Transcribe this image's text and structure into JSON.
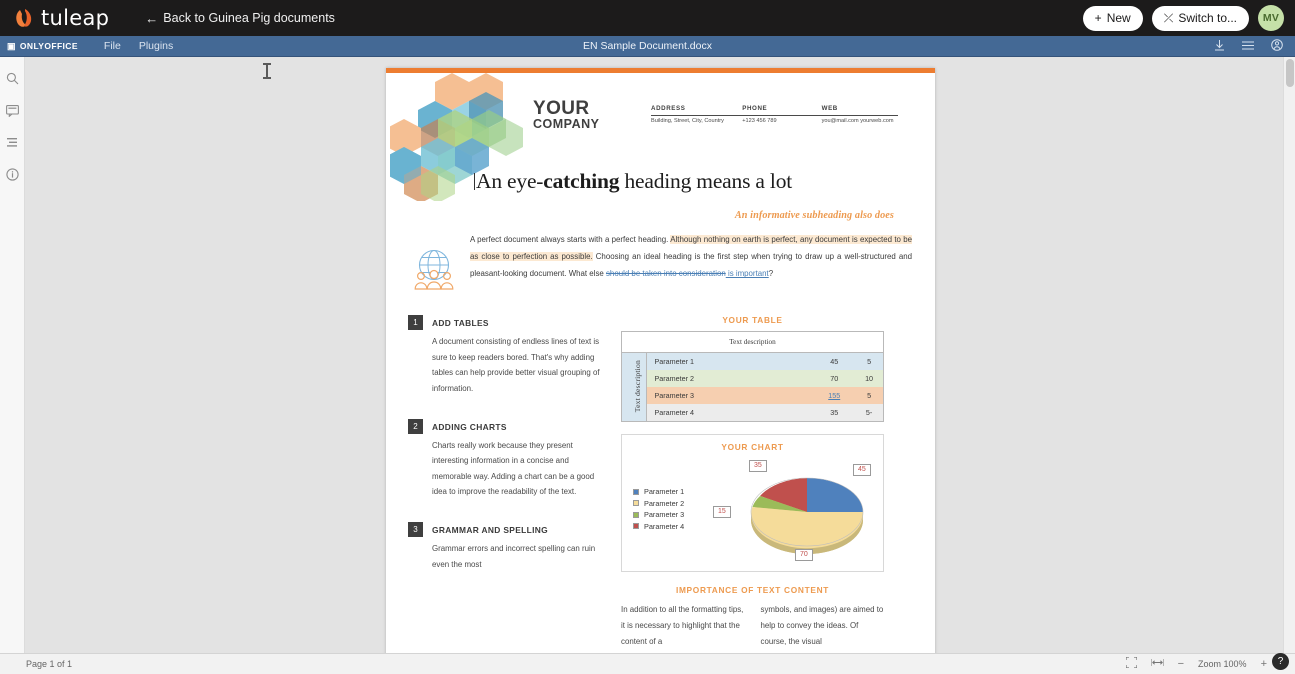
{
  "topbar": {
    "brand": "tuleap",
    "back_label": "Back to Guinea Pig documents",
    "back_arrow": "←",
    "new_label": "New",
    "new_glyph": "+",
    "switch_label": "Switch to...",
    "switch_glyph": "⤫",
    "avatar_initials": "MV",
    "avatar_color": "#c5e0a8"
  },
  "editor_bar": {
    "brand": "ONLYOFFICE",
    "menu": [
      "File",
      "Plugins"
    ],
    "document_title": "EN Sample Document.docx",
    "icons": [
      "download-icon",
      "menu-icon",
      "account-icon"
    ],
    "bg_color": "#446995"
  },
  "rail": {
    "items": [
      "search-icon",
      "comments-icon",
      "headings-icon",
      "about-icon"
    ]
  },
  "document": {
    "accent_color": "#ed7d31",
    "company_line1": "YOUR",
    "company_line2": "COMPANY",
    "contact": [
      {
        "heading": "ADDRESS",
        "value": "Building, Street, City, Country"
      },
      {
        "heading": "PHONE",
        "value": "+123 456 789"
      },
      {
        "heading": "WEB",
        "value": "you@mail.com yourweb.com"
      }
    ],
    "title_parts": [
      {
        "text": "An eye-",
        "bold": false
      },
      {
        "text": "catching",
        "bold": true
      },
      {
        "text": " heading means a lot",
        "bold": false
      }
    ],
    "title_plain": "An eye-catching heading means a lot",
    "subheading": "An informative subheading also does",
    "intro": {
      "p1": "A perfect document always starts with a perfect heading. ",
      "highlight": "Although nothing on earth is perfect, any document is expected to be as close to perfection as possible.",
      "p2": " Choosing an ideal heading is the first step when trying to draw up a well-structured and pleasant-looking document. What else ",
      "deleted": "should be taken into consideration",
      "inserted": " is important",
      "p3": "?"
    },
    "sections": [
      {
        "number": "1",
        "title": "ADD TABLES",
        "body": "A document consisting of endless lines of text is sure to keep readers bored. That's why adding tables can help provide better visual grouping of information."
      },
      {
        "number": "2",
        "title": "ADDING CHARTS",
        "body": "Charts really work because they present interesting information in a concise and memorable way. Adding a chart can be a good idea to improve the readability of the text."
      },
      {
        "number": "3",
        "title": "GRAMMAR AND SPELLING",
        "body": "Grammar errors and incorrect spelling can ruin even the most"
      }
    ],
    "table": {
      "caption": "YOUR TABLE",
      "column_header": "Text description",
      "row_header": "Text description",
      "rows": [
        {
          "label": "Parameter 1",
          "v1": "45",
          "v2": "5"
        },
        {
          "label": "Parameter 2",
          "v1": "70",
          "v2": "10"
        },
        {
          "label": "Parameter 3",
          "v1": "155",
          "v2": "5"
        },
        {
          "label": "Parameter 4",
          "v1": "35",
          "v2": "5-"
        }
      ],
      "row_colors": [
        "#d7e6f0",
        "#e2ecd4",
        "#f6cfb0",
        "#ececec"
      ]
    },
    "chart": {
      "caption": "YOUR CHART"
    },
    "text_content": {
      "heading": "IMPORTANCE OF TEXT CONTENT",
      "col1": "In addition to all the formatting tips, it is necessary to highlight that the content of a",
      "col2": "symbols, and images) are aimed to help to convey the ideas. Of course, the visual"
    }
  },
  "chart_data": {
    "type": "pie",
    "title": "YOUR CHART",
    "categories": [
      "Parameter 1",
      "Parameter 2",
      "Parameter 3",
      "Parameter 4"
    ],
    "values": [
      45,
      70,
      15,
      35
    ],
    "colors": [
      "#4f81bd",
      "#f5dc9a",
      "#9bbb59",
      "#c0504d"
    ],
    "legend_position": "left",
    "data_labels": [
      "45",
      "70",
      "15",
      "35"
    ],
    "grid": false
  },
  "status": {
    "page_label": "Page 1 of 1",
    "fit_page_icon": "fit-page-icon",
    "fit_width_icon": "fit-width-icon",
    "zoom_out": "−",
    "zoom_label": "Zoom 100%",
    "zoom_in": "+",
    "help_glyph": "?"
  }
}
